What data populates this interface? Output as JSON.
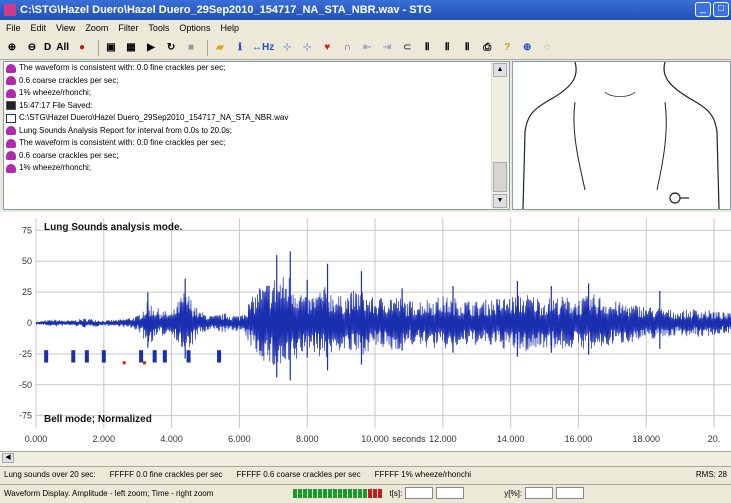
{
  "window": {
    "title": "C:\\STG\\Hazel Duero\\Hazel Duero_29Sep2010_154717_NA_STA_NBR.wav - STG",
    "buttons": [
      "_",
      "□"
    ]
  },
  "menu": [
    "File",
    "Edit",
    "View",
    "Zoom",
    "Filter",
    "Tools",
    "Options",
    "Help"
  ],
  "toolbar": {
    "items": [
      {
        "type": "icon",
        "name": "zoom-in-icon",
        "glyph": "⊕"
      },
      {
        "type": "icon",
        "name": "zoom-out-icon",
        "glyph": "⊖"
      },
      {
        "type": "text",
        "name": "d-button",
        "label": "D"
      },
      {
        "type": "text",
        "name": "all-button",
        "label": "All"
      },
      {
        "type": "icon",
        "name": "record-icon",
        "glyph": "●",
        "color": "#c81818"
      },
      {
        "type": "sep"
      },
      {
        "type": "icon",
        "name": "save-icon",
        "glyph": "▣"
      },
      {
        "type": "icon",
        "name": "save-as-icon",
        "glyph": "▦"
      },
      {
        "type": "icon",
        "name": "play-icon",
        "glyph": "▶"
      },
      {
        "type": "icon",
        "name": "replay-icon",
        "glyph": "↻"
      },
      {
        "type": "icon",
        "name": "stop-icon",
        "glyph": "■",
        "color": "#999999"
      },
      {
        "type": "sep"
      },
      {
        "type": "icon",
        "name": "open-folder-icon",
        "glyph": "▰",
        "color": "#d9a520"
      },
      {
        "type": "icon",
        "name": "info-icon",
        "glyph": "ℹ",
        "color": "#1f4fc0"
      },
      {
        "type": "text",
        "name": "hz-button",
        "label": "↔Hz",
        "color": "#1f4fc0"
      },
      {
        "type": "icon",
        "name": "split-left-icon",
        "glyph": "⊹",
        "color": "#88a0c0"
      },
      {
        "type": "icon",
        "name": "split-right-icon",
        "glyph": "⊹",
        "color": "#88a0c0"
      },
      {
        "type": "icon",
        "name": "heart-icon",
        "glyph": "♥",
        "color": "#d41a1a"
      },
      {
        "type": "icon",
        "name": "lung-icon",
        "glyph": "∩",
        "color": "#b02ab0"
      },
      {
        "type": "icon",
        "name": "move-left-icon",
        "glyph": "⇤",
        "color": "#a0a0c0"
      },
      {
        "type": "icon",
        "name": "move-right-icon",
        "glyph": "⇥",
        "color": "#a0a0c0"
      },
      {
        "type": "icon",
        "name": "loop-icon",
        "glyph": "⊂",
        "color": "#555555"
      },
      {
        "type": "icon",
        "name": "filter-1-icon",
        "glyph": "Ⅱ"
      },
      {
        "type": "icon",
        "name": "filter-2-icon",
        "glyph": "Ⅱ"
      },
      {
        "type": "icon",
        "name": "filter-3-icon",
        "glyph": "Ⅱ"
      },
      {
        "type": "icon",
        "name": "print-icon",
        "glyph": "⎙"
      },
      {
        "type": "icon",
        "name": "help-icon",
        "glyph": "?",
        "color": "#d4a010"
      },
      {
        "type": "icon",
        "name": "zoom-icon",
        "glyph": "⊕",
        "color": "#1f4fc0"
      },
      {
        "type": "icon",
        "name": "zoom-small-icon",
        "glyph": "◌",
        "color": "#888888"
      }
    ]
  },
  "log": {
    "lines": [
      {
        "icon": "lung",
        "text": "The waveform is consistent with: 0.0 fine crackles per sec;"
      },
      {
        "icon": "lung",
        "text": "0.6 coarse crackles per sec;"
      },
      {
        "icon": "lung",
        "text": "1% wheeze/rhonchi;"
      },
      {
        "icon": "disk",
        "text": "15:47:17  File Saved:"
      },
      {
        "icon": "file",
        "text": "C:\\STG\\Hazel Duero\\Hazel Duero_29Sep2010_154717_NA_STA_NBR.wav"
      },
      {
        "icon": "lung",
        "text": "Lung Sounds Analysis Report for interval from 0.0s to 20.0s;"
      },
      {
        "icon": "lung",
        "text": "The waveform is consistent with: 0.0 fine crackles per sec;"
      },
      {
        "icon": "lung",
        "text": "0.6 coarse crackles per sec;"
      },
      {
        "icon": "lung",
        "text": "1% wheeze/rhonchi;"
      }
    ]
  },
  "chart_data": {
    "type": "line",
    "title": "Lung Sounds analysis mode.",
    "subtitle": "Bell mode; Normalized",
    "xlabel": "seconds",
    "xlim": [
      0,
      20.5
    ],
    "ylim": [
      -85,
      85
    ],
    "yticks": [
      75,
      50,
      25,
      0,
      -25,
      -50,
      -75
    ],
    "xticks": [
      {
        "v": 0,
        "label": "0.000"
      },
      {
        "v": 2,
        "label": "2.000"
      },
      {
        "v": 4,
        "label": "4.000"
      },
      {
        "v": 6,
        "label": "6.000"
      },
      {
        "v": 8,
        "label": "8.000"
      },
      {
        "v": 10,
        "label": "10.000"
      },
      {
        "v": 12,
        "label": "12.000"
      },
      {
        "v": 14,
        "label": "14.000"
      },
      {
        "v": 16,
        "label": "16.000"
      },
      {
        "v": 18,
        "label": "18.000"
      },
      {
        "v": 20,
        "label": "20."
      }
    ],
    "grid": true,
    "colors": {
      "wave": "#1a2fb0",
      "marker": "#1a2fb0",
      "crackle": "#e01818",
      "grid": "#c8c8c8"
    },
    "envelope": [
      {
        "t": 0.0,
        "a": 1
      },
      {
        "t": 0.5,
        "a": 3
      },
      {
        "t": 1.0,
        "a": 2
      },
      {
        "t": 1.5,
        "a": 4
      },
      {
        "t": 2.0,
        "a": 2
      },
      {
        "t": 2.5,
        "a": 3
      },
      {
        "t": 3.0,
        "a": 6
      },
      {
        "t": 3.3,
        "a": 18
      },
      {
        "t": 3.6,
        "a": 12
      },
      {
        "t": 4.0,
        "a": 8
      },
      {
        "t": 4.4,
        "a": 28
      },
      {
        "t": 4.8,
        "a": 10
      },
      {
        "t": 5.2,
        "a": 6
      },
      {
        "t": 5.6,
        "a": 8
      },
      {
        "t": 6.0,
        "a": 6
      },
      {
        "t": 6.5,
        "a": 26
      },
      {
        "t": 7.0,
        "a": 38
      },
      {
        "t": 7.5,
        "a": 40
      },
      {
        "t": 8.0,
        "a": 20
      },
      {
        "t": 8.5,
        "a": 30
      },
      {
        "t": 9.0,
        "a": 22
      },
      {
        "t": 9.5,
        "a": 28
      },
      {
        "t": 10.0,
        "a": 20
      },
      {
        "t": 10.5,
        "a": 24
      },
      {
        "t": 11.0,
        "a": 18
      },
      {
        "t": 11.5,
        "a": 20
      },
      {
        "t": 12.0,
        "a": 22
      },
      {
        "t": 12.5,
        "a": 20
      },
      {
        "t": 13.0,
        "a": 18
      },
      {
        "t": 13.5,
        "a": 20
      },
      {
        "t": 14.0,
        "a": 22
      },
      {
        "t": 14.5,
        "a": 24
      },
      {
        "t": 15.0,
        "a": 20
      },
      {
        "t": 15.5,
        "a": 22
      },
      {
        "t": 16.0,
        "a": 20
      },
      {
        "t": 16.5,
        "a": 24
      },
      {
        "t": 17.0,
        "a": 18
      },
      {
        "t": 17.5,
        "a": 16
      },
      {
        "t": 18.0,
        "a": 14
      },
      {
        "t": 18.5,
        "a": 12
      },
      {
        "t": 19.0,
        "a": 10
      },
      {
        "t": 19.5,
        "a": 12
      },
      {
        "t": 20.0,
        "a": 10
      },
      {
        "t": 20.5,
        "a": 8
      }
    ],
    "spikes": [
      {
        "t": 3.3,
        "a": 25
      },
      {
        "t": 4.4,
        "a": 36
      },
      {
        "t": 6.6,
        "a": 28
      },
      {
        "t": 7.1,
        "a": 55
      },
      {
        "t": 7.5,
        "a": 58
      },
      {
        "t": 8.0,
        "a": 35
      },
      {
        "t": 8.6,
        "a": 48
      },
      {
        "t": 9.6,
        "a": 42
      },
      {
        "t": 10.8,
        "a": 28
      },
      {
        "t": 12.3,
        "a": 30
      },
      {
        "t": 14.2,
        "a": 34
      },
      {
        "t": 15.2,
        "a": 30
      },
      {
        "t": 16.3,
        "a": 32
      },
      {
        "t": 18.4,
        "a": 26
      }
    ],
    "wheeze_markers": [
      0.3,
      1.1,
      1.5,
      2.0,
      3.1,
      3.5,
      3.8,
      4.5,
      5.4
    ],
    "crackle_markers": [
      2.6,
      3.2
    ]
  },
  "status": {
    "line1": [
      "Lung sounds over 20 sec:",
      "FFFFF 0.0 fine crackles per sec",
      "FFFFF 0.6 coarse crackles per sec",
      "FFFFF 1% wheeze/rhonchi",
      "RMS: 28"
    ],
    "line2_left": "Waveform Display. Amplitude - left zoom; Time - right zoom",
    "t_label": "t[s]:",
    "y_label": "y[%]:",
    "meter_green": 15,
    "meter_red": 3
  }
}
